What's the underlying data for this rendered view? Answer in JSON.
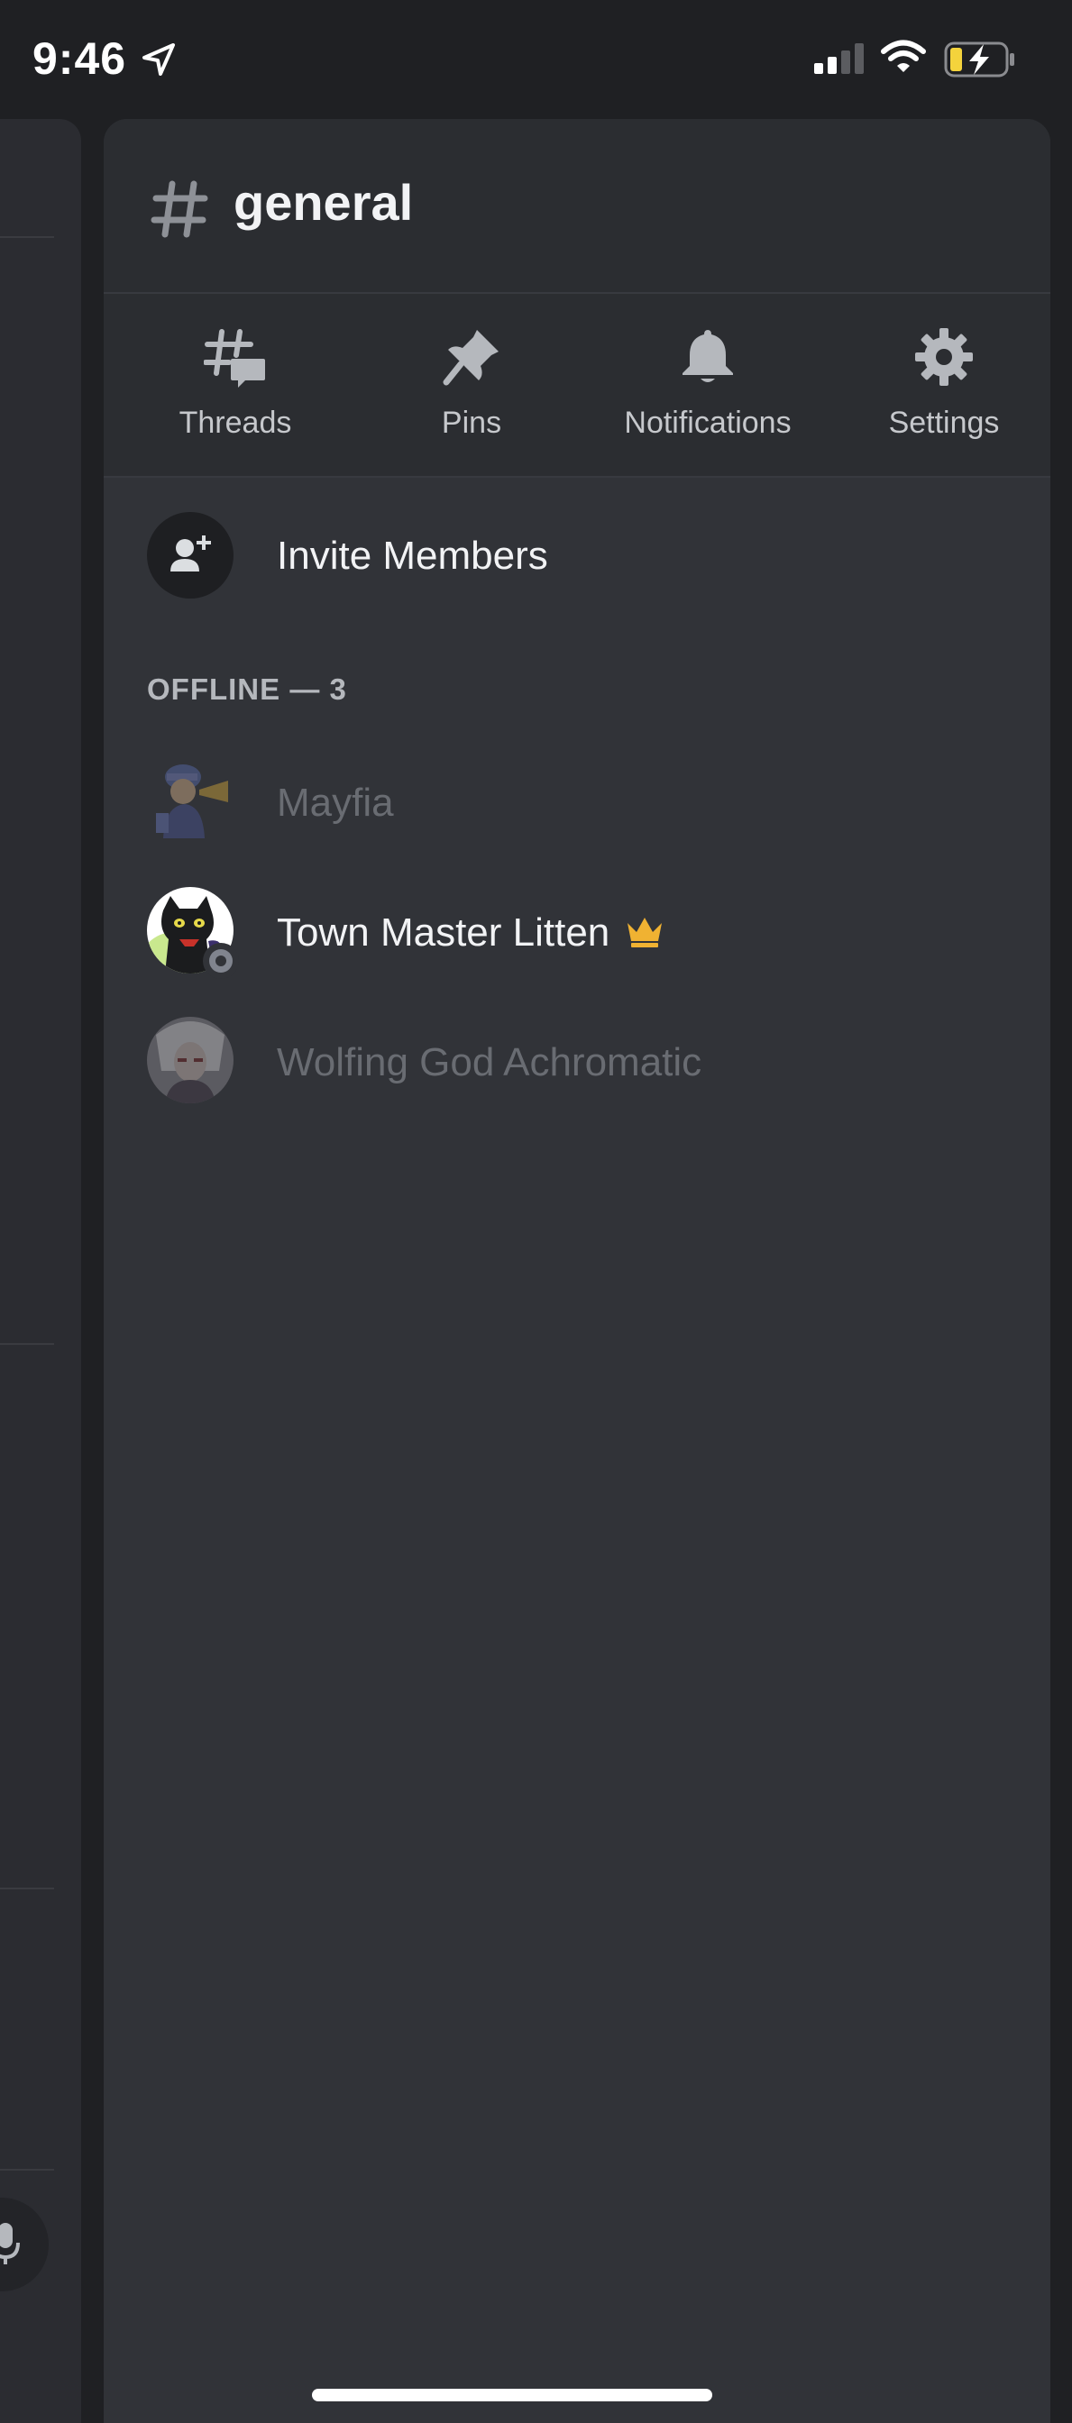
{
  "status_bar": {
    "time": "9:46",
    "icons": [
      "location-arrow-icon",
      "signal-icon",
      "wifi-icon",
      "battery-charging-icon"
    ],
    "battery_color": "#f4d33c"
  },
  "channel": {
    "name": "general",
    "icon": "hash-icon"
  },
  "toolbar": {
    "items": [
      {
        "label": "Threads",
        "icon": "threads-icon"
      },
      {
        "label": "Pins",
        "icon": "pin-icon"
      },
      {
        "label": "Notifications",
        "icon": "bell-icon"
      },
      {
        "label": "Settings",
        "icon": "gear-icon"
      }
    ]
  },
  "invite": {
    "label": "Invite Members",
    "icon": "add-person-icon"
  },
  "members": {
    "section_header": "OFFLINE — 3",
    "list": [
      {
        "name": "Mayfia",
        "status": "offline"
      },
      {
        "name": "Town Master Litten",
        "status": "owner",
        "badge": "crown-icon",
        "badge_color": "#f0b232"
      },
      {
        "name": "Wolfing God Achromatic",
        "status": "offline"
      }
    ]
  },
  "colors": {
    "background": "#1f2023",
    "drawer": "#313338",
    "header": "#2b2d31",
    "text_primary": "#f2f3f5",
    "text_muted": "#696c72"
  }
}
